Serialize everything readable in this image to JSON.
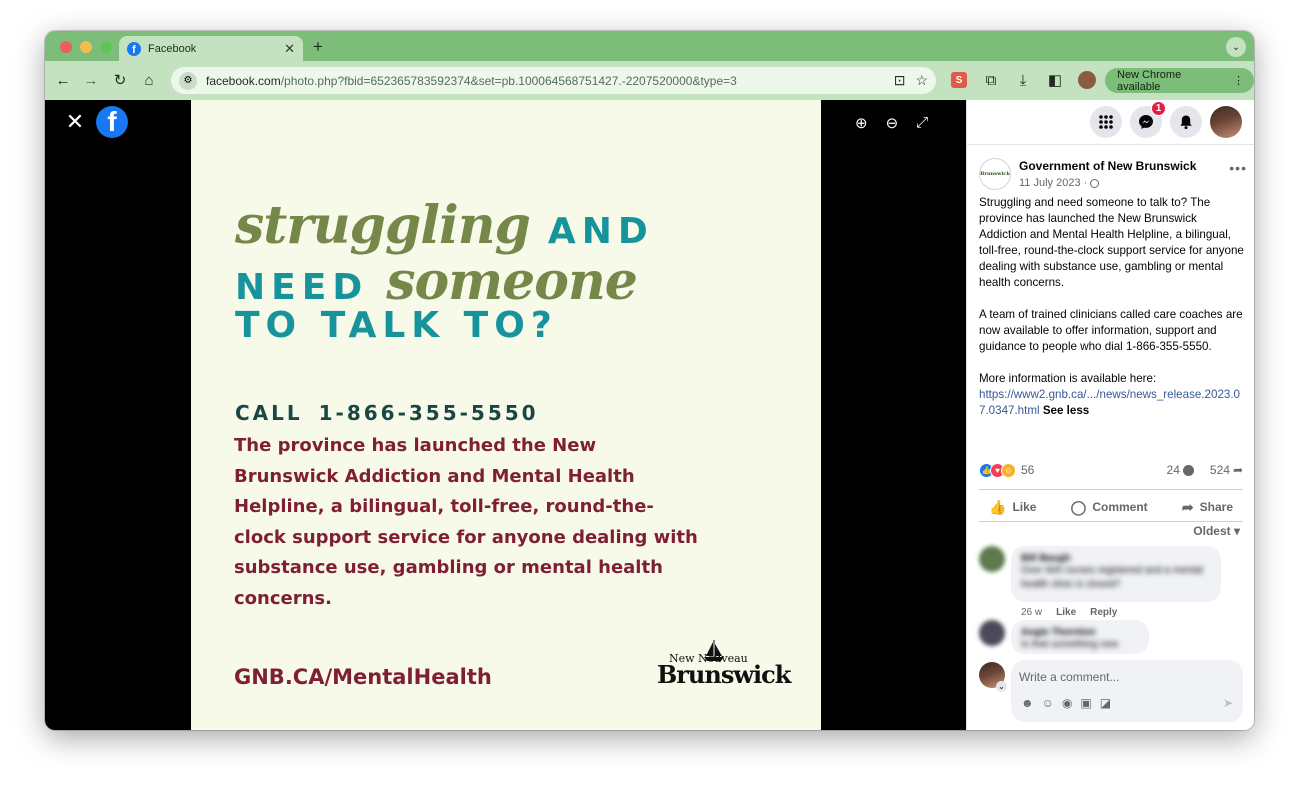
{
  "browser": {
    "tab_title": "Facebook",
    "url_host": "facebook.com",
    "url_path": "/photo.php?fbid=652365783592374&set=pb.100064568751427.-2207520000&type=3",
    "update_label": "New Chrome available",
    "ext_label": "S"
  },
  "poster": {
    "line1_script": "struggling",
    "line1_caps": "AND",
    "line2_caps": "NEED",
    "line2_script": "someone",
    "line3_caps": "TO TALK TO?",
    "call": "CALL  1-866-355-5550",
    "body": "The province has launched the New Brunswick Addiction and Mental Health Helpline, a bilingual, toll-free, round-the-clock support service for anyone dealing with substance use, gambling or mental health concerns.",
    "url": "GNB.CA/MentalHealth",
    "logo_small": "New Nouveau",
    "logo_big": "Brunswick"
  },
  "sidebar": {
    "messenger_badge": "1",
    "page_avatar_text": "Brunswick",
    "post": {
      "page_name": "Government of New Brunswick",
      "date": "11 July 2023 ·",
      "para1": "Struggling and need someone to talk to? The province has launched the New Brunswick Addiction and Mental Health Helpline, a bilingual, toll-free, round-the-clock support service for anyone dealing with substance use, gambling or mental health concerns.",
      "para2": "A team of trained clinicians called care coaches are now available to offer information, support and guidance to people who dial 1-866-355-5550.",
      "para3": "More information is available here:",
      "link": "https://www2.gnb.ca/.../news/news_release.2023.07.0347.html",
      "see_less": "See less",
      "reaction_count": "56",
      "comment_count": "24",
      "share_count": "524",
      "like_label": "Like",
      "comment_label": "Comment",
      "share_label": "Share",
      "sort_label": "Oldest"
    },
    "comments": [
      {
        "name": "Bill Baugh",
        "text": "Over 600 nurses registered and a mental health clinic is closed?",
        "time": "26 w",
        "like": "Like",
        "reply": "Reply"
      },
      {
        "name": "Angie Thornton",
        "text": "Is that something new"
      }
    ],
    "composer": {
      "placeholder": "Write a comment..."
    }
  },
  "colors": {
    "tab_strip": "#7cbd7a",
    "toolbar": "#c4e2c0",
    "facebook_blue": "#1877f2",
    "poster_bg": "#f8fae9",
    "poster_olive": "#76874a",
    "poster_teal": "#17939b",
    "poster_maroon": "#7e1f35"
  }
}
